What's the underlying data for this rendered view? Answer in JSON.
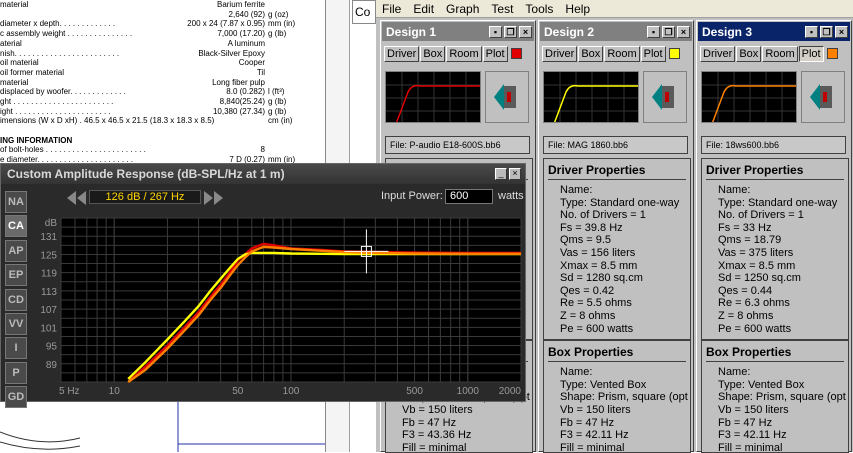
{
  "background_doc": {
    "lines": [
      {
        "label": "material",
        "value": "Barium ferrite",
        "unit": ""
      },
      {
        "label": "",
        "value": "2,640 (92)",
        "unit": "g (oz)"
      },
      {
        "label": "diameter x depth. . . . . . . . . . . . .",
        "value": "200 x 24 (7.87 x 0.95)",
        "unit": "mm (in)"
      },
      {
        "label": "c assembly weight . . . . . . . . . . . . . . .",
        "value": "7,000 (17.20)",
        "unit": "g (lb)"
      },
      {
        "label": "aterial",
        "value": "A luminum",
        "unit": ""
      },
      {
        "label": "nish. . . . . . . . . . . . . . . . . . . . . . . .",
        "value": "Black-Silver Epoxy",
        "unit": ""
      },
      {
        "label": "oil material",
        "value": "Cooper",
        "unit": ""
      },
      {
        "label": "oil former material",
        "value": "Til",
        "unit": ""
      },
      {
        "label": "material",
        "value": "Long fiber pulp",
        "unit": ""
      },
      {
        "label": "displaced by woofer. . . . . . . . . . . . .",
        "value": "8.0 (0.282)",
        "unit": "l (ft³)"
      },
      {
        "label": "ght . . . . . . . . . . . . . . . . . . . . . . .",
        "value": "8,840(25.24)",
        "unit": "g (lb)"
      },
      {
        "label": "ight . . . . . . . . . . . . . . . . . . . . . .",
        "value": "10,380 (27.34)",
        "unit": "g (lb)"
      },
      {
        "label": "imensions (W x D xH) . 46.5 x 46.5 x 21.5 (18.3 x 18.3 x 8.5)",
        "value": "",
        "unit": "cm (in)"
      }
    ],
    "heading": "ING INFORMATION",
    "lines2": [
      {
        "label": "of bolt-holes . . . . . . . . . . . . . . . . . . . . . . .",
        "value": "8",
        "unit": ""
      },
      {
        "label": "e diameter. . . . . . . . . . . . . . . . . . . . . .",
        "value": "7 D (0.27)",
        "unit": "mm (in)"
      }
    ]
  },
  "sidebox_label": "Co",
  "menu": [
    "File",
    "Edit",
    "Graph",
    "Test",
    "Tools",
    "Help"
  ],
  "tab_labels": [
    "Driver",
    "Box",
    "Room",
    "Plot"
  ],
  "props_headers": {
    "driver": "Driver Properties",
    "box": "Box Properties"
  },
  "designs": [
    {
      "title": "Design 1",
      "active": false,
      "plot_color": "#e00000",
      "file": "File: P-audio E18-600S.bb6",
      "driver": [
        "Name:",
        "Type: Standard one-way",
        "No. of Drivers = 1",
        "Fs = 39.8 Hz",
        "Qms = 9.5",
        "Vas = 156 liters",
        "Xmax = 8.5 mm",
        "Sd = 1280 sq.cm",
        "Qes = 0.42",
        "Re = 5.5 ohms",
        "Z = 8 ohms",
        "Pe = 600 watts"
      ],
      "box": [
        "Name:",
        "Type: Vented Box",
        "Shape: Prism, square (opt",
        "Vb = 150 liters",
        "Fb = 47 Hz",
        "F3 = 43.36 Hz",
        "Fill = minimal"
      ]
    },
    {
      "title": "Design 2",
      "active": false,
      "plot_color": "#ffff00",
      "file": "File: MAG 1860.bb6",
      "driver": [
        "Name:",
        "Type: Standard one-way",
        "No. of Drivers = 1",
        "Fs = 39.8 Hz",
        "Qms = 9.5",
        "Vas = 156 liters",
        "Xmax = 8.5 mm",
        "Sd = 1280 sq.cm",
        "Qes = 0.42",
        "Re = 5.5 ohms",
        "Z = 8 ohms",
        "Pe = 600 watts"
      ],
      "box": [
        "Name:",
        "Type: Vented Box",
        "Shape: Prism, square (opt",
        "Vb = 150 liters",
        "Fb = 47 Hz",
        "F3 = 42.11 Hz",
        "Fill = minimal"
      ]
    },
    {
      "title": "Design 3",
      "active": true,
      "plot_color": "#ff8000",
      "file": "File: 18ws600.bb6",
      "driver": [
        "Name:",
        "Type: Standard one-way",
        "No. of Drivers = 1",
        "Fs = 33 Hz",
        "Qms = 18.79",
        "Vas = 375 liters",
        "Xmax = 8.5 mm",
        "Sd = 1250 sq.cm",
        "Qes = 0.44",
        "Re = 6.3 ohms",
        "Z = 8 ohms",
        "Pe = 600 watts"
      ],
      "box": [
        "Name:",
        "Type: Vented Box",
        "Shape: Prism, square (opt",
        "Vb = 150 liters",
        "Fb = 47 Hz",
        "F3 = 42.11 Hz",
        "Fill = minimal"
      ]
    }
  ],
  "car": {
    "title": "Custom Amplitude Response (dB-SPL/Hz at 1 m)",
    "readout": "126 dB / 267 Hz",
    "input_power_label": "Input Power:",
    "input_power_value": "600",
    "input_power_unit": "watts",
    "side_buttons": [
      "NA",
      "CA",
      "AP",
      "EP",
      "CD",
      "VV",
      "I",
      "P",
      "GD"
    ],
    "active_side": "CA",
    "partial_box": [
      "Fb = 47 Hz",
      "F3 = 43.36 Hz",
      "Fill = minimal"
    ]
  },
  "chart_data": {
    "type": "line",
    "xlabel": "",
    "ylabel": "dB",
    "xscale": "log",
    "xlim": [
      5,
      2000
    ],
    "ylim": [
      83,
      137
    ],
    "x_ticks": [
      5,
      10,
      50,
      100,
      500,
      1000,
      2000
    ],
    "x_tick_labels": [
      "5 Hz",
      "10",
      "50",
      "100",
      "500",
      "1000",
      "2000"
    ],
    "y_ticks": [
      89,
      95,
      101,
      107,
      113,
      119,
      125,
      131
    ],
    "grid": true,
    "colors": {
      "bg": "#000000",
      "grid": "#3a3a3a",
      "design1": "#e00000",
      "design2": "#ffff00",
      "design3": "#ff8000"
    },
    "series": [
      {
        "x": [
          12,
          15,
          20,
          25,
          30,
          35,
          40,
          45,
          50,
          55,
          60,
          70,
          80,
          100,
          150,
          200,
          300,
          500,
          1000,
          2000
        ],
        "y": [
          83,
          88,
          95,
          101,
          106,
          111,
          115,
          119,
          123,
          125,
          127,
          128.5,
          128,
          127,
          126.5,
          126,
          125.8,
          125.6,
          125.5,
          125.5
        ]
      },
      {
        "x": [
          12,
          15,
          20,
          25,
          30,
          35,
          40,
          45,
          50,
          55,
          60,
          70,
          80,
          100,
          150,
          200,
          300,
          500,
          1000,
          2000
        ],
        "y": [
          84,
          89.5,
          97,
          103,
          108,
          113,
          117,
          120.5,
          123.5,
          125,
          125.5,
          125.5,
          125.5,
          125.3,
          125.2,
          125.1,
          125.1,
          125.1,
          125.1,
          125.1
        ]
      },
      {
        "x": [
          12,
          15,
          20,
          25,
          30,
          35,
          40,
          45,
          50,
          55,
          60,
          70,
          80,
          100,
          150,
          200,
          300,
          500,
          1000,
          2000
        ],
        "y": [
          82,
          87,
          94,
          100,
          105,
          110,
          114,
          118,
          121.5,
          124,
          126,
          127.5,
          127.3,
          126.8,
          126.2,
          125.8,
          125.5,
          125.3,
          125.2,
          125.2
        ]
      }
    ],
    "cursor": {
      "x": 267,
      "y": 126
    }
  }
}
